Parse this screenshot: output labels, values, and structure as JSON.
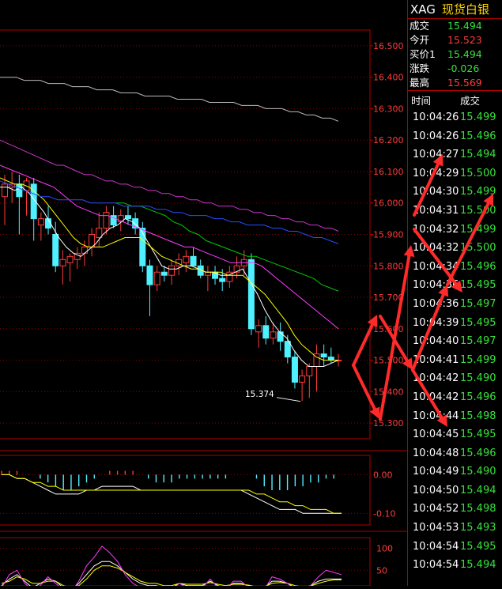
{
  "quote": {
    "symbol": "XAG",
    "name": "现货白银",
    "rows": [
      {
        "label": "成交",
        "value": "15.494",
        "color": "green"
      },
      {
        "label": "今开",
        "value": "15.523",
        "color": "red"
      },
      {
        "label": "买价1",
        "value": "15.494",
        "color": "green"
      },
      {
        "label": "涨跌",
        "value": "-0.026",
        "color": "green"
      },
      {
        "label": "最高",
        "value": "15.569",
        "color": "red"
      }
    ],
    "ticks_header": {
      "time": "时间",
      "price": "成交"
    },
    "ticks": [
      {
        "time": "10:04:26",
        "price": "15.499"
      },
      {
        "time": "10:04:26",
        "price": "15.496"
      },
      {
        "time": "10:04:27",
        "price": "15.494"
      },
      {
        "time": "10:04:29",
        "price": "15.500"
      },
      {
        "time": "10:04:30",
        "price": "15.499"
      },
      {
        "time": "10:04:31",
        "price": "15.500"
      },
      {
        "time": "10:04:32",
        "price": "15.499"
      },
      {
        "time": "10:04:32",
        "price": "15.500"
      },
      {
        "time": "10:04:34",
        "price": "15.496"
      },
      {
        "time": "10:04:36",
        "price": "15.495"
      },
      {
        "time": "10:04:36",
        "price": "15.497"
      },
      {
        "time": "10:04:39",
        "price": "15.495"
      },
      {
        "time": "10:04:40",
        "price": "15.497"
      },
      {
        "time": "10:04:41",
        "price": "15.499"
      },
      {
        "time": "10:04:42",
        "price": "15.490"
      },
      {
        "time": "10:04:42",
        "price": "15.496"
      },
      {
        "time": "10:04:44",
        "price": "15.498"
      },
      {
        "time": "10:04:45",
        "price": "15.495"
      },
      {
        "time": "10:04:48",
        "price": "15.496"
      },
      {
        "time": "10:04:49",
        "price": "15.490"
      },
      {
        "time": "10:04:50",
        "price": "15.494"
      },
      {
        "time": "10:04:52",
        "price": "15.498"
      },
      {
        "time": "10:04:53",
        "price": "15.493"
      },
      {
        "time": "10:04:54",
        "price": "15.495"
      },
      {
        "time": "10:04:54",
        "price": "15.494"
      }
    ]
  },
  "chart_data": {
    "type": "candlestick",
    "price_axis": {
      "ticks": [
        "16.500",
        "16.400",
        "16.300",
        "16.200",
        "16.100",
        "16.000",
        "15.900",
        "15.800",
        "15.700",
        "15.600",
        "15.500",
        "15.400",
        "15.300"
      ],
      "range": [
        15.25,
        16.55
      ]
    },
    "low_annotation": "15.374",
    "candles": [
      {
        "o": 16.02,
        "h": 16.09,
        "l": 15.93,
        "c": 16.06
      },
      {
        "o": 16.05,
        "h": 16.1,
        "l": 16.0,
        "c": 16.06
      },
      {
        "o": 16.06,
        "h": 16.09,
        "l": 15.9,
        "c": 16.02
      },
      {
        "o": 16.04,
        "h": 16.08,
        "l": 15.96,
        "c": 16.07
      },
      {
        "o": 16.06,
        "h": 16.08,
        "l": 15.88,
        "c": 15.95
      },
      {
        "o": 15.93,
        "h": 15.97,
        "l": 15.88,
        "c": 15.95
      },
      {
        "o": 15.95,
        "h": 15.99,
        "l": 15.9,
        "c": 15.92
      },
      {
        "o": 15.9,
        "h": 15.94,
        "l": 15.78,
        "c": 15.8
      },
      {
        "o": 15.8,
        "h": 15.85,
        "l": 15.74,
        "c": 15.82
      },
      {
        "o": 15.81,
        "h": 15.84,
        "l": 15.75,
        "c": 15.83
      },
      {
        "o": 15.82,
        "h": 15.86,
        "l": 15.79,
        "c": 15.84
      },
      {
        "o": 15.84,
        "h": 15.88,
        "l": 15.8,
        "c": 15.86
      },
      {
        "o": 15.86,
        "h": 15.92,
        "l": 15.83,
        "c": 15.9
      },
      {
        "o": 15.89,
        "h": 15.97,
        "l": 15.86,
        "c": 15.92
      },
      {
        "o": 15.92,
        "h": 15.99,
        "l": 15.9,
        "c": 15.97
      },
      {
        "o": 15.96,
        "h": 15.99,
        "l": 15.92,
        "c": 15.93
      },
      {
        "o": 15.94,
        "h": 15.98,
        "l": 15.91,
        "c": 15.96
      },
      {
        "o": 15.96,
        "h": 15.99,
        "l": 15.93,
        "c": 15.95
      },
      {
        "o": 15.95,
        "h": 15.97,
        "l": 15.9,
        "c": 15.92
      },
      {
        "o": 15.92,
        "h": 15.94,
        "l": 15.78,
        "c": 15.8
      },
      {
        "o": 15.8,
        "h": 15.82,
        "l": 15.64,
        "c": 15.74
      },
      {
        "o": 15.74,
        "h": 15.8,
        "l": 15.72,
        "c": 15.78
      },
      {
        "o": 15.78,
        "h": 15.8,
        "l": 15.75,
        "c": 15.77
      },
      {
        "o": 15.77,
        "h": 15.82,
        "l": 15.74,
        "c": 15.8
      },
      {
        "o": 15.8,
        "h": 15.84,
        "l": 15.77,
        "c": 15.82
      },
      {
        "o": 15.81,
        "h": 15.85,
        "l": 15.78,
        "c": 15.83
      },
      {
        "o": 15.83,
        "h": 15.86,
        "l": 15.8,
        "c": 15.8
      },
      {
        "o": 15.8,
        "h": 15.82,
        "l": 15.76,
        "c": 15.77
      },
      {
        "o": 15.77,
        "h": 15.8,
        "l": 15.72,
        "c": 15.78
      },
      {
        "o": 15.78,
        "h": 15.8,
        "l": 15.74,
        "c": 15.76
      },
      {
        "o": 15.76,
        "h": 15.79,
        "l": 15.72,
        "c": 15.75
      },
      {
        "o": 15.75,
        "h": 15.8,
        "l": 15.73,
        "c": 15.78
      },
      {
        "o": 15.78,
        "h": 15.83,
        "l": 15.76,
        "c": 15.8
      },
      {
        "o": 15.8,
        "h": 15.85,
        "l": 15.77,
        "c": 15.82
      },
      {
        "o": 15.82,
        "h": 15.84,
        "l": 15.58,
        "c": 15.6
      },
      {
        "o": 15.59,
        "h": 15.63,
        "l": 15.54,
        "c": 15.61
      },
      {
        "o": 15.61,
        "h": 15.64,
        "l": 15.55,
        "c": 15.57
      },
      {
        "o": 15.57,
        "h": 15.62,
        "l": 15.55,
        "c": 15.59
      },
      {
        "o": 15.59,
        "h": 15.62,
        "l": 15.53,
        "c": 15.56
      },
      {
        "o": 15.56,
        "h": 15.58,
        "l": 15.49,
        "c": 15.51
      },
      {
        "o": 15.51,
        "h": 15.53,
        "l": 15.41,
        "c": 15.43
      },
      {
        "o": 15.43,
        "h": 15.47,
        "l": 15.37,
        "c": 15.45
      },
      {
        "o": 15.45,
        "h": 15.49,
        "l": 15.38,
        "c": 15.48
      },
      {
        "o": 15.48,
        "h": 15.55,
        "l": 15.4,
        "c": 15.52
      },
      {
        "o": 15.52,
        "h": 15.55,
        "l": 15.48,
        "c": 15.51
      },
      {
        "o": 15.51,
        "h": 15.54,
        "l": 15.49,
        "c": 15.5
      },
      {
        "o": 15.5,
        "h": 15.52,
        "l": 15.48,
        "c": 15.5
      }
    ],
    "moving_averages": [
      {
        "color": "#ffffff",
        "values": [
          16.05,
          16.05,
          16.04,
          16.05,
          16.03,
          16.0,
          15.97,
          15.93,
          15.89,
          15.86,
          15.84,
          15.83,
          15.85,
          15.87,
          15.9,
          15.92,
          15.93,
          15.95,
          15.94,
          15.92,
          15.88,
          15.84,
          15.8,
          15.79,
          15.79,
          15.8,
          15.8,
          15.79,
          15.78,
          15.78,
          15.77,
          15.77,
          15.78,
          15.79,
          15.75,
          15.71,
          15.66,
          15.62,
          15.59,
          15.57,
          15.53,
          15.5,
          15.48,
          15.48,
          15.48,
          15.49,
          15.5
        ]
      },
      {
        "color": "#ffff00",
        "values": [
          16.08,
          16.07,
          16.06,
          16.06,
          16.05,
          16.03,
          16.01,
          15.98,
          15.95,
          15.92,
          15.89,
          15.87,
          15.86,
          15.86,
          15.86,
          15.87,
          15.88,
          15.89,
          15.89,
          15.89,
          15.87,
          15.85,
          15.83,
          15.82,
          15.81,
          15.8,
          15.79,
          15.79,
          15.78,
          15.78,
          15.78,
          15.77,
          15.77,
          15.77,
          15.75,
          15.73,
          15.71,
          15.68,
          15.65,
          15.62,
          15.58,
          15.55,
          15.53,
          15.51,
          15.5,
          15.5,
          15.5
        ]
      },
      {
        "color": "#ff3cff",
        "values": [
          16.12,
          16.11,
          16.1,
          16.09,
          16.08,
          16.07,
          16.06,
          16.05,
          16.03,
          16.01,
          15.99,
          15.98,
          15.97,
          15.96,
          15.96,
          15.95,
          15.94,
          15.93,
          15.92,
          15.91,
          15.9,
          15.89,
          15.88,
          15.87,
          15.86,
          15.86,
          15.85,
          15.84,
          15.83,
          15.82,
          15.81,
          15.81,
          15.81,
          15.81,
          15.8,
          15.78,
          15.76,
          15.74,
          15.72,
          15.7,
          15.68,
          15.66,
          15.64,
          15.62,
          15.6
        ]
      },
      {
        "color": "#00cc00",
        "values": [
          null,
          null,
          null,
          null,
          null,
          null,
          null,
          null,
          null,
          null,
          null,
          null,
          null,
          null,
          16.0,
          16.0,
          15.99,
          15.99,
          15.98,
          15.97,
          15.96,
          15.94,
          15.93,
          15.91,
          15.9,
          15.88,
          15.87,
          15.86,
          15.85,
          15.84,
          15.83,
          15.83,
          15.82,
          15.81,
          15.8,
          15.79,
          15.78,
          15.77,
          15.76,
          15.74,
          15.73,
          15.72
        ]
      },
      {
        "color": "#2a4cff",
        "values": [
          16.07,
          16.06,
          16.05,
          16.04,
          16.03,
          16.02,
          16.02,
          16.01,
          16.01,
          16.01,
          16.01,
          16.0,
          16.0,
          16.0,
          16.0,
          15.99,
          15.99,
          15.99,
          15.99,
          15.98,
          15.98,
          15.97,
          15.97,
          15.96,
          15.96,
          15.96,
          15.95,
          15.95,
          15.94,
          15.94,
          15.93,
          15.93,
          15.93,
          15.92,
          15.92,
          15.91,
          15.91,
          15.9,
          15.89,
          15.89,
          15.88,
          15.87
        ]
      },
      {
        "color": "#cc33cc",
        "values": [
          16.2,
          16.19,
          16.18,
          16.17,
          16.16,
          16.15,
          16.14,
          16.13,
          16.12,
          16.12,
          16.11,
          16.1,
          16.09,
          16.09,
          16.08,
          16.07,
          16.07,
          16.06,
          16.06,
          16.05,
          16.05,
          16.04,
          16.04,
          16.03,
          16.03,
          16.02,
          16.02,
          16.01,
          16.01,
          16.0,
          16.0,
          15.99,
          15.99,
          15.99,
          15.98,
          15.98,
          15.97,
          15.97,
          15.96,
          15.96,
          15.95,
          15.95,
          15.94,
          15.94,
          15.93,
          15.93,
          15.92,
          15.92,
          15.91
        ]
      },
      {
        "color": "#bbbbbb",
        "values": [
          16.4,
          16.4,
          16.4,
          16.39,
          16.39,
          16.39,
          16.38,
          16.38,
          16.38,
          16.37,
          16.37,
          16.37,
          16.36,
          16.36,
          16.36,
          16.35,
          16.35,
          16.35,
          16.34,
          16.34,
          16.34,
          16.34,
          16.33,
          16.33,
          16.33,
          16.33,
          16.32,
          16.32,
          16.32,
          16.32,
          16.31,
          16.31,
          16.31,
          16.3,
          16.3,
          16.3,
          16.29,
          16.29,
          16.28,
          16.28,
          16.27,
          16.27,
          16.26
        ]
      }
    ],
    "macd": {
      "axis_ticks": [
        "0.00",
        "-0.10"
      ],
      "range": [
        -0.13,
        0.05
      ],
      "hist": [
        0.01,
        0.01,
        0.01,
        0.0,
        0.0,
        -0.01,
        -0.02,
        -0.03,
        -0.04,
        -0.04,
        -0.03,
        -0.02,
        -0.01,
        0.0,
        0.01,
        0.01,
        0.01,
        0.01,
        0.0,
        -0.01,
        -0.02,
        -0.02,
        -0.02,
        -0.01,
        -0.01,
        -0.01,
        -0.01,
        -0.01,
        -0.01,
        -0.01,
        0.0,
        0.0,
        0.0,
        -0.01,
        -0.03,
        -0.04,
        -0.04,
        -0.04,
        -0.03,
        -0.03,
        -0.02,
        -0.02,
        -0.01,
        -0.01,
        0.0
      ],
      "dif": [
        0.0,
        0.0,
        -0.01,
        -0.01,
        -0.02,
        -0.03,
        -0.04,
        -0.05,
        -0.05,
        -0.05,
        -0.05,
        -0.04,
        -0.04,
        -0.03,
        -0.03,
        -0.03,
        -0.03,
        -0.03,
        -0.04,
        -0.04,
        -0.04,
        -0.04,
        -0.04,
        -0.04,
        -0.04,
        -0.04,
        -0.04,
        -0.04,
        -0.04,
        -0.04,
        -0.04,
        -0.04,
        -0.05,
        -0.06,
        -0.07,
        -0.08,
        -0.09,
        -0.09,
        -0.09,
        -0.1,
        -0.1,
        -0.1,
        -0.1,
        -0.1,
        -0.1
      ],
      "dea": [
        0.0,
        0.0,
        -0.01,
        -0.01,
        -0.02,
        -0.02,
        -0.03,
        -0.03,
        -0.04,
        -0.04,
        -0.04,
        -0.04,
        -0.04,
        -0.04,
        -0.04,
        -0.04,
        -0.04,
        -0.04,
        -0.04,
        -0.04,
        -0.04,
        -0.04,
        -0.04,
        -0.04,
        -0.04,
        -0.04,
        -0.04,
        -0.04,
        -0.04,
        -0.04,
        -0.04,
        -0.04,
        -0.04,
        -0.05,
        -0.05,
        -0.06,
        -0.07,
        -0.07,
        -0.08,
        -0.08,
        -0.09,
        -0.09,
        -0.09,
        -0.1,
        -0.1
      ]
    },
    "kdj": {
      "axis_ticks": [
        "100",
        "50"
      ],
      "range": [
        0,
        110
      ],
      "k": [
        15,
        30,
        40,
        25,
        10,
        20,
        30,
        25,
        10,
        5,
        20,
        40,
        60,
        70,
        70,
        60,
        45,
        30,
        20,
        15,
        15,
        10,
        10,
        20,
        15,
        15,
        15,
        25,
        15,
        10,
        20,
        20,
        15,
        10,
        10,
        25,
        25,
        20,
        10,
        10,
        15,
        25,
        30,
        30,
        30
      ],
      "d": [
        20,
        25,
        35,
        30,
        20,
        20,
        25,
        25,
        15,
        10,
        15,
        30,
        50,
        60,
        60,
        55,
        45,
        35,
        25,
        20,
        20,
        15,
        15,
        20,
        18,
        18,
        18,
        22,
        18,
        15,
        18,
        18,
        16,
        12,
        12,
        20,
        22,
        20,
        15,
        12,
        14,
        20,
        25,
        28,
        28
      ],
      "j": [
        10,
        40,
        50,
        20,
        5,
        15,
        35,
        20,
        5,
        0,
        25,
        60,
        80,
        105,
        90,
        70,
        40,
        20,
        10,
        10,
        10,
        5,
        5,
        20,
        10,
        10,
        10,
        30,
        10,
        5,
        25,
        25,
        10,
        5,
        5,
        35,
        30,
        20,
        5,
        5,
        15,
        35,
        50,
        45,
        40
      ]
    }
  }
}
